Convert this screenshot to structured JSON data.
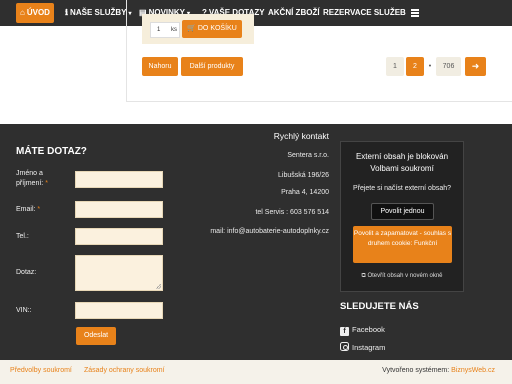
{
  "nav": {
    "items": [
      {
        "label": "ÚVOD",
        "icon": "home-icon"
      },
      {
        "label": "NAŠE SLUŽBY",
        "icon": "info-icon"
      },
      {
        "label": "NOVINKY",
        "icon": "newspaper-icon"
      },
      {
        "label": "VAŠE DOTAZY",
        "icon": "question-icon"
      },
      {
        "label": "AKČNÍ ZBOŽÍ"
      },
      {
        "label": "REZERVACE SLUŽEB"
      }
    ],
    "menu_icon": "hamburger-icon",
    "colors": {
      "bar": "#2f2f2f",
      "accent": "#e8821a"
    }
  },
  "product": {
    "qty": "1",
    "unit": "ks",
    "cart_button": "DO KOŠÍKU",
    "cart_icon": "cart-icon"
  },
  "actions": {
    "back": "Nahoru",
    "more": "Další produkty"
  },
  "pagination": {
    "pages": [
      "1",
      "2",
      "•",
      "706"
    ],
    "current": "2",
    "next_icon": "arrow-right-icon"
  },
  "footer": {
    "form": {
      "title": "MÁTE DOTAZ?",
      "name_label": "Jméno a příjmení:",
      "email_label": "Email:",
      "phone_label": "Tel.:",
      "question_label": "Dotaz:",
      "vin_label": "VIN::",
      "required_mark": "*",
      "submit": "Odeslat"
    },
    "contact": {
      "title": "Rychlý kontakt",
      "company": "Sentera s.r.o.",
      "street": "Libušská 196/26",
      "city": "Praha 4, 14200",
      "phone": "tel Servis : 603 576 514",
      "email": "mail: info@autobaterie-autodoplnky.cz"
    },
    "external": {
      "title": "Externí obsah je blokován Volbami soukromí",
      "question": "Přejete si načíst externí obsah?",
      "allow_once": "Povolit jednou",
      "allow_save": "Povolit a zapamatovat - souhlas s druhem cookie: Funkční",
      "open_new": "Otevřít obsah v novém okně",
      "open_icon": "external-link-icon"
    },
    "social": {
      "title": "SLEDUJETE NÁS",
      "facebook": "Facebook",
      "instagram": "Instagram"
    }
  },
  "bottom": {
    "privacy_prefs": "Předvolby soukromí",
    "privacy_policy": "Zásady ochrany soukromí",
    "created_by": "Vytvořeno systémem:",
    "system": "BiznysWeb.cz"
  }
}
